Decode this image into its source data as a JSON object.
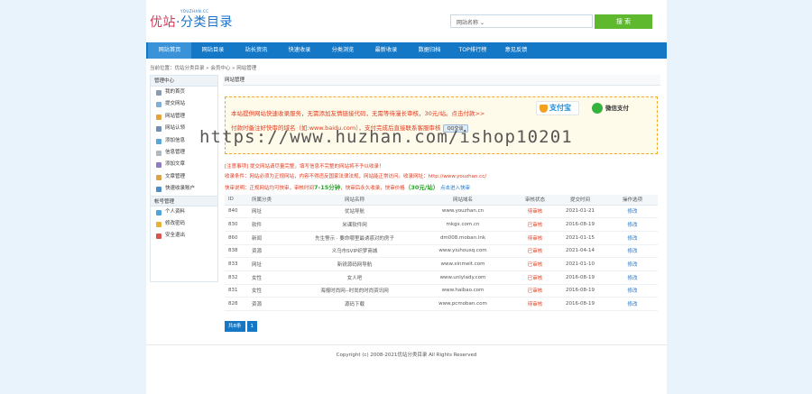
{
  "header": {
    "logo_main": "优站",
    "logo_dot": "·",
    "logo_sub": "分类目录",
    "logo_url": "YOUZHAN.CC",
    "search_select": "网站名称",
    "search_button": "搜 索"
  },
  "nav": [
    "网站首页",
    "网站目录",
    "站长资讯",
    "快速收录",
    "分类浏览",
    "最新收录",
    "数据归档",
    "TOP排行榜",
    "意见反馈"
  ],
  "breadcrumb": "当前位置：优站分类目录 » 会员中心 » 网站管理",
  "sidebar": {
    "group1": "管理中心",
    "group1_items": [
      "我的首页",
      "提交网站",
      "网站管理",
      "网站认领",
      "添加信息",
      "信息管理",
      "添加文章",
      "文章管理",
      "快速收录账户"
    ],
    "group2": "帐号管理",
    "group2_items": [
      "个人资料",
      "修改密码",
      "安全退出"
    ]
  },
  "main_title": "网站管理",
  "notice": {
    "line1": "本站提供网站快速收录服务，无需添加友情链接代码，无需等待漫长审核，30元/站。点击付款>>",
    "alipay": "支付宝",
    "wechat": "微信支付",
    "line2": "付款时备注好快审的域名（如:www.baidu.com），支付完成后直接联系客服审核",
    "qq": "QQ交谈"
  },
  "watermark": "https://www.huzhan.com/ishop10201",
  "info": {
    "line1": "[注意事项] 提交网站请尽量完整，填写信息不完整的网站将不予以收录！",
    "line2": "收录条件：网站必须为正规网站，内容不得违反国家法律法规，网站能正常访问。收录网址：http://www.youzhan.cc/",
    "line3_a": "快审说明：正规网站均可快审，审核时间",
    "line3_time": "7-15分钟",
    "line3_b": "，快审后永久收录，快审价格",
    "line3_price": "（30元/站）",
    "line3_link": "点击进入快审"
  },
  "table": {
    "headers": [
      "ID",
      "所属分类",
      "网站名称",
      "网站域名",
      "审核状态",
      "提交时间",
      "操作选项"
    ],
    "rows": [
      {
        "id": "840",
        "cat": "网址",
        "name": "优站导航",
        "url": "www.youzhan.cn",
        "status": "待审核",
        "red": true,
        "time": "2021-01-21",
        "op": "修改"
      },
      {
        "id": "830",
        "cat": "软件",
        "name": "米课软件网",
        "url": "mkgx.com.cn",
        "status": "已审核",
        "red": true,
        "time": "2016-08-19",
        "op": "修改"
      },
      {
        "id": "860",
        "cat": "新闻",
        "name": "先生警示 · 要命哪里最诱惑对的房子",
        "url": "dm008.moban.ink",
        "status": "待审核",
        "red": true,
        "time": "2021-01-15",
        "op": "修改"
      },
      {
        "id": "838",
        "cat": "资源",
        "name": "义乌市SVIP织梦商城",
        "url": "www.yiuhousq.com",
        "status": "已审核",
        "red": true,
        "time": "2021-04-14",
        "op": "修改"
      },
      {
        "id": "833",
        "cat": "网址",
        "name": "新锐源码网导航",
        "url": "www.xinmeit.com",
        "status": "已审核",
        "red": true,
        "time": "2021-01-10",
        "op": "修改"
      },
      {
        "id": "832",
        "cat": "女性",
        "name": "女人吧",
        "url": "www.unlylady.com",
        "status": "已审核",
        "red": true,
        "time": "2016-08-19",
        "op": "修改"
      },
      {
        "id": "831",
        "cat": "女性",
        "name": "海报时尚网--时尚的时尚资讯网",
        "url": "www.haibao.com",
        "status": "已审核",
        "red": true,
        "time": "2016-08-19",
        "op": "修改"
      },
      {
        "id": "828",
        "cat": "资源",
        "name": "源码下载",
        "url": "www.pcmoban.com",
        "status": "待审核",
        "red": true,
        "time": "2016-08-19",
        "op": "修改"
      }
    ]
  },
  "pager": {
    "total": "共8条",
    "page": "1"
  },
  "footer": "Copyright (c) 2008-2021优站分类目录 All Rights Reserved",
  "colors": {
    "nav": "#1478c7",
    "search_button": "#5eb92f",
    "notice_text": "#e03a1e"
  }
}
